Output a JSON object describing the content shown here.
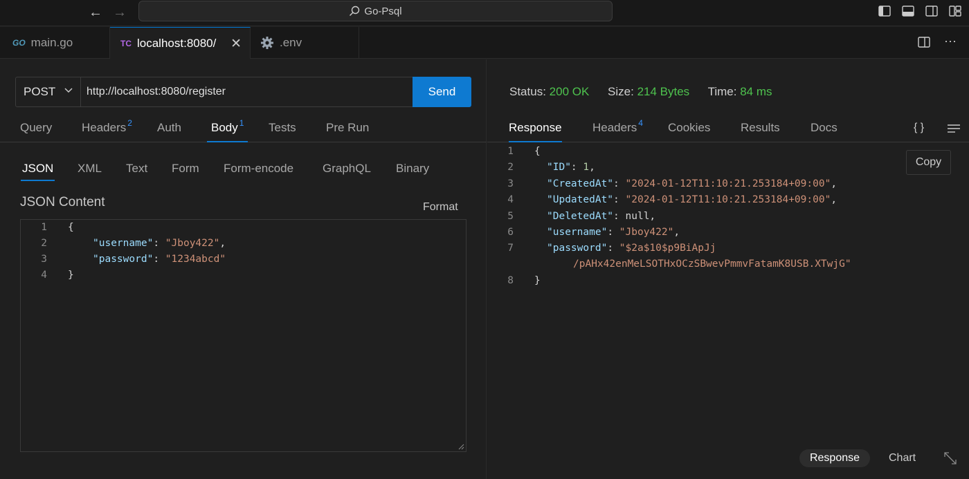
{
  "titlebar": {
    "title": "Go-Psql"
  },
  "tabs": [
    {
      "label": "main.go",
      "icon_text": "GO",
      "icon_color": "#519aba"
    },
    {
      "label": "localhost:8080/",
      "icon_text": "TC",
      "icon_color": "#b267e6"
    },
    {
      "label": ".env",
      "icon": "gear-icon"
    }
  ],
  "request": {
    "method": "POST",
    "url": "http://localhost:8080/register",
    "send_label": "Send",
    "tabs": {
      "query": "Query",
      "headers": "Headers",
      "headers_count": "2",
      "auth": "Auth",
      "body": "Body",
      "body_count": "1",
      "tests": "Tests",
      "pre_run": "Pre Run"
    },
    "body_types": {
      "json": "JSON",
      "xml": "XML",
      "text": "Text",
      "form": "Form",
      "form_encode": "Form-encode",
      "graphql": "GraphQL",
      "binary": "Binary"
    },
    "content_label": "JSON Content",
    "format_label": "Format",
    "body_lines": {
      "l1": "{",
      "l2_key": "\"username\"",
      "l2_sep": ": ",
      "l2_val": "\"Jboy422\"",
      "l2_end": ",",
      "l3_key": "\"password\"",
      "l3_sep": ": ",
      "l3_val": "\"1234abcd\"",
      "l4": "}"
    },
    "line_numbers": [
      "1",
      "2",
      "3",
      "4"
    ]
  },
  "response": {
    "status_label": "Status:",
    "status_value": "200 OK",
    "size_label": "Size:",
    "size_value": "214 Bytes",
    "time_label": "Time:",
    "time_value": "84 ms",
    "tabs": {
      "response": "Response",
      "headers": "Headers",
      "headers_count": "4",
      "cookies": "Cookies",
      "results": "Results",
      "docs": "Docs"
    },
    "copy_label": "Copy",
    "line_numbers": [
      "1",
      "2",
      "3",
      "4",
      "5",
      "6",
      "7",
      "8"
    ],
    "lines": {
      "l1": "{",
      "id_key": "\"ID\"",
      "id_val": "1",
      "created_key": "\"CreatedAt\"",
      "created_val": "\"2024-01-12T11:10:21.253184+09:00\"",
      "updated_key": "\"UpdatedAt\"",
      "updated_val": "\"2024-01-12T11:10:21.253184+09:00\"",
      "deleted_key": "\"DeletedAt\"",
      "deleted_val": "null",
      "username_key": "\"username\"",
      "username_val": "\"Jboy422\"",
      "password_key": "\"password\"",
      "password_val_1": "\"$2a$10$p9BiApJj",
      "password_val_2": "/pAHx42enMeLSOTHxOCzSBwevPmmvFatamK8USB.XTwjG\"",
      "l8": "}"
    },
    "bottom": {
      "response_label": "Response",
      "chart_label": "Chart"
    }
  },
  "colors": {
    "accent": "#0e7ad1",
    "status_ok": "#4ec24e",
    "json_key": "#9cdcfe",
    "json_string": "#ce9178"
  }
}
